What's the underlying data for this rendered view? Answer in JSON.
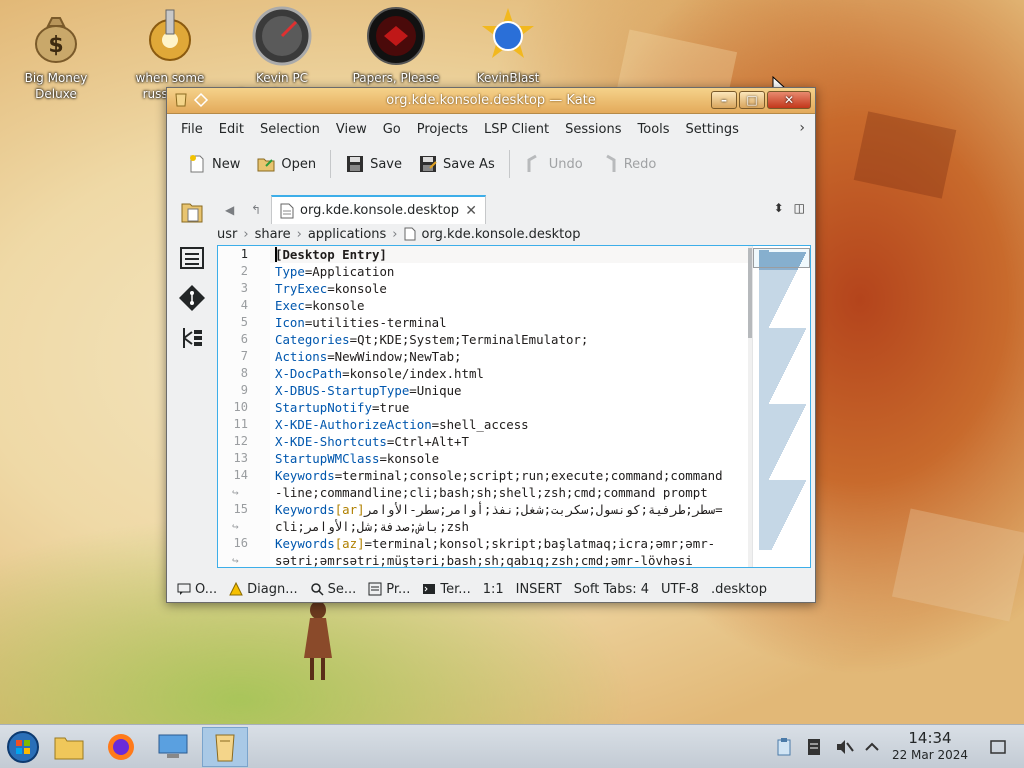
{
  "desktop": {
    "icons": [
      {
        "label": "Big Money\nDeluxe",
        "icon": "money-bag-icon"
      },
      {
        "label": "when some\nrussian...",
        "icon": "gear-icon"
      },
      {
        "label": "Kevin PC\nOptimizer Ho...",
        "icon": "speedometer-icon"
      },
      {
        "label": "Papers, Please",
        "icon": "papers-please-icon"
      },
      {
        "label": "KevinBlast",
        "icon": "kevinblast-icon"
      }
    ]
  },
  "window": {
    "title": "org.kde.konsole.desktop — Kate",
    "menu": [
      "File",
      "Edit",
      "Selection",
      "View",
      "Go",
      "Projects",
      "LSP Client",
      "Sessions",
      "Tools",
      "Settings"
    ],
    "toolbar": {
      "new": "New",
      "open": "Open",
      "save": "Save",
      "save_as": "Save As",
      "undo": "Undo",
      "redo": "Redo"
    },
    "tab": {
      "name": "org.kde.konsole.desktop"
    },
    "breadcrumb": [
      "usr",
      "share",
      "applications",
      "org.kde.konsole.desktop"
    ],
    "lines": [
      {
        "n": "1",
        "key": "",
        "locale": "",
        "value": "[Desktop Entry]"
      },
      {
        "n": "2",
        "key": "Type",
        "locale": "",
        "value": "=Application"
      },
      {
        "n": "3",
        "key": "TryExec",
        "locale": "",
        "value": "=konsole"
      },
      {
        "n": "4",
        "key": "Exec",
        "locale": "",
        "value": "=konsole"
      },
      {
        "n": "5",
        "key": "Icon",
        "locale": "",
        "value": "=utilities-terminal"
      },
      {
        "n": "6",
        "key": "Categories",
        "locale": "",
        "value": "=Qt;KDE;System;TerminalEmulator;"
      },
      {
        "n": "7",
        "key": "Actions",
        "locale": "",
        "value": "=NewWindow;NewTab;"
      },
      {
        "n": "8",
        "key": "X-DocPath",
        "locale": "",
        "value": "=konsole/index.html"
      },
      {
        "n": "9",
        "key": "X-DBUS-StartupType",
        "locale": "",
        "value": "=Unique"
      },
      {
        "n": "10",
        "key": "StartupNotify",
        "locale": "",
        "value": "=true"
      },
      {
        "n": "11",
        "key": "X-KDE-AuthorizeAction",
        "locale": "",
        "value": "=shell_access"
      },
      {
        "n": "12",
        "key": "X-KDE-Shortcuts",
        "locale": "",
        "value": "=Ctrl+Alt+T"
      },
      {
        "n": "13",
        "key": "StartupWMClass",
        "locale": "",
        "value": "=konsole"
      },
      {
        "n": "14",
        "key": "Keywords",
        "locale": "",
        "value": "=terminal;console;script;run;execute;command;command"
      },
      {
        "n": "",
        "key": "",
        "locale": "",
        "value": "-line;commandline;cli;bash;sh;shell;zsh;cmd;command prompt"
      },
      {
        "n": "15",
        "key": "Keywords",
        "locale": "[ar]",
        "value": "=سطر;طرفية;كونسول;سكربت;شغل;نفذ;أوامر;سطر-الأوامر"
      },
      {
        "n": "",
        "key": "",
        "locale": "",
        "value": "cli;باش;صدفة;شل;الأوامر;zsh"
      },
      {
        "n": "16",
        "key": "Keywords",
        "locale": "[az]",
        "value": "=terminal;konsol;skript;başlatmaq;icra;əmr;əmr-"
      },
      {
        "n": "",
        "key": "",
        "locale": "",
        "value": "sətri;əmrsətri;müştəri;bash;sh;qabıq;zsh;cmd;əmr-lövhəsi"
      }
    ],
    "status": {
      "output": "O...",
      "diagnostics": "Diagn...",
      "search": "Se...",
      "projects": "Pr...",
      "terminal": "Ter...",
      "position": "1:1",
      "mode": "INSERT",
      "indent": "Soft Tabs: 4",
      "encoding": "UTF-8",
      "filetype": ".desktop"
    }
  },
  "taskbar": {
    "apps": [
      "start-orb-icon",
      "file-manager-icon",
      "firefox-icon",
      "system-settings-icon",
      "kate-icon"
    ],
    "clock": {
      "time": "14:34",
      "date": "22 Mar 2024"
    }
  },
  "colors": {
    "accent": "#3daee9",
    "key": "#0057ae",
    "locale": "#b08000",
    "titlebar": "#e3aa5b"
  }
}
